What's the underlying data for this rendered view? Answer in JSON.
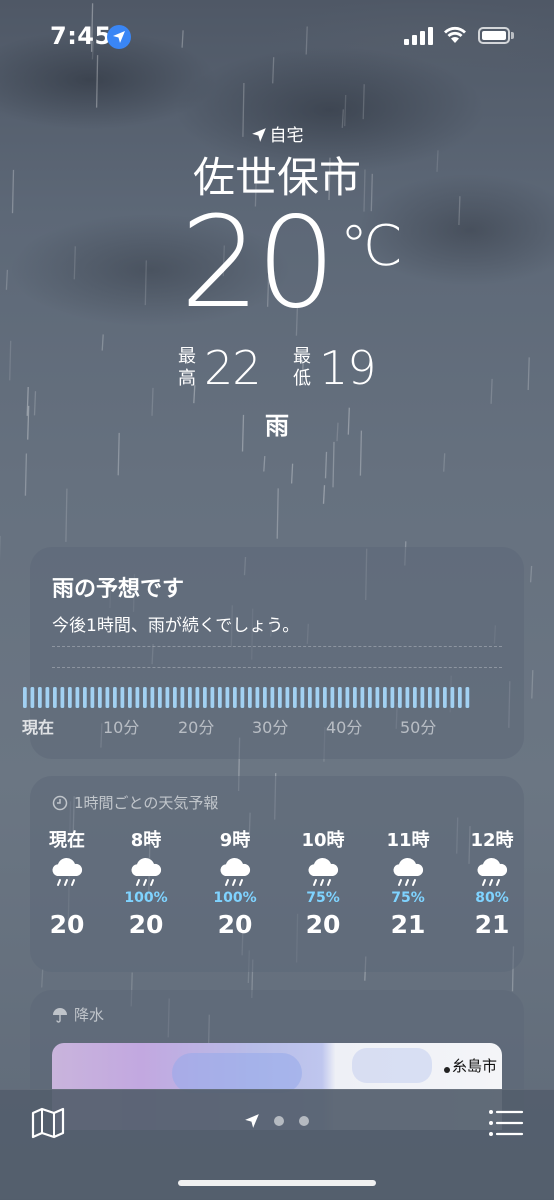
{
  "status_bar": {
    "time": "7:45"
  },
  "header": {
    "location_label": "自宅",
    "city": "佐世保市",
    "temperature": "20",
    "unit": "℃",
    "high_label": "最高",
    "high": "22",
    "low_label": "最低",
    "low": "19",
    "condition": "雨"
  },
  "rain_card": {
    "title": "雨の予想です",
    "subtitle": "今後1時間、雨が続くでしょう。",
    "ticks": [
      "現在",
      "10分",
      "20分",
      "30分",
      "40分",
      "50分"
    ]
  },
  "hourly_card": {
    "heading": "1時間ごとの天気予報",
    "hours": [
      {
        "label": "現在",
        "icon": "rain-cloud-icon",
        "chance": "",
        "temp": "20"
      },
      {
        "label": "8時",
        "icon": "rain-cloud-icon",
        "chance": "100%",
        "temp": "20"
      },
      {
        "label": "9時",
        "icon": "rain-cloud-icon",
        "chance": "100%",
        "temp": "20"
      },
      {
        "label": "10時",
        "icon": "rain-cloud-icon",
        "chance": "75%",
        "temp": "20"
      },
      {
        "label": "11時",
        "icon": "rain-cloud-icon",
        "chance": "75%",
        "temp": "21"
      },
      {
        "label": "12時",
        "icon": "rain-cloud-icon",
        "chance": "80%",
        "temp": "21"
      }
    ]
  },
  "precip_card": {
    "heading": "降水",
    "map_place": "糸島市"
  },
  "colors": {
    "accent_blue": "#3a86f5",
    "precip_percent": "#7fd3ff",
    "rain_bar": "#a9dcff"
  }
}
